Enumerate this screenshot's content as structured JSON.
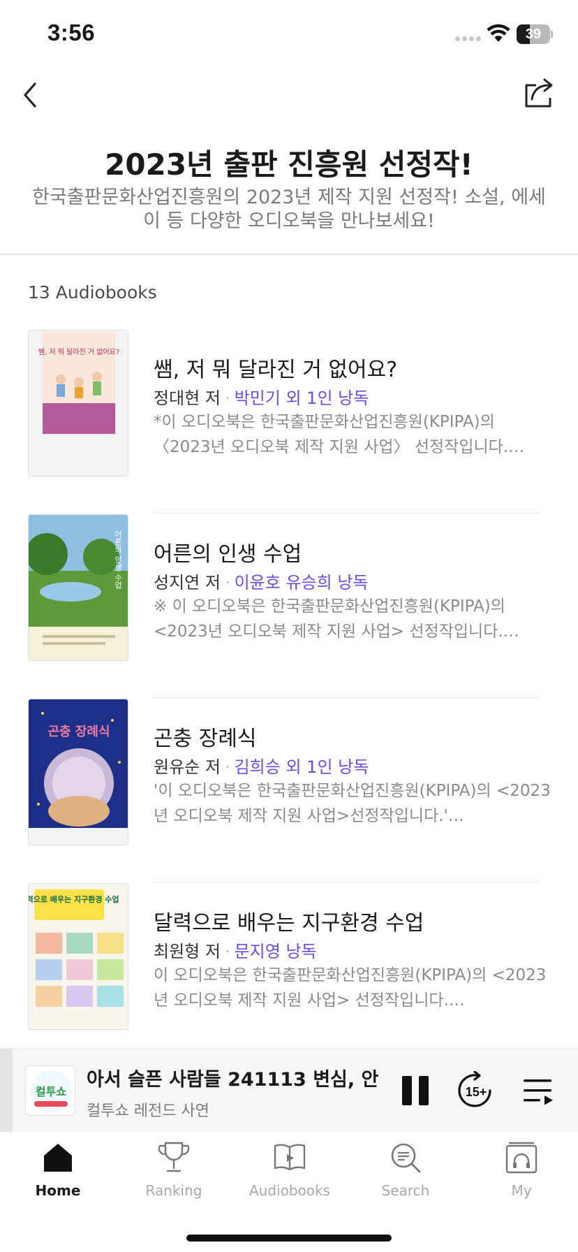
{
  "status_bar": {
    "time": "3:56",
    "battery": "39",
    "battery_level": 0.39
  },
  "header": {
    "title": "2023년 출판 진흥원 선정작!",
    "subtitle": "한국출판문화산업진흥원의 2023년 제작 지원 선정작! 소설, 에세이 등 다양한 오디오북을 만나보세요!"
  },
  "list": {
    "count_label": "13 Audiobooks",
    "books": [
      {
        "title": "쌤, 저 뭐 달라진 거 없어요?",
        "author": "정대현 저",
        "narrator": "박민기 외 1인 낭독",
        "description": "*이 오디오북은 한국출판문화산업진흥원(KPIPA)의 〈2023년 오디오북 제작 지원 사업〉 선정작입니다.…",
        "cover_text": "쌤, 저 뭐 달라진 거 없어요?"
      },
      {
        "title": "어른의 인생 수업",
        "author": "성지연 저",
        "narrator": "이윤호 유승희 낭독",
        "description": "※ 이 오디오북은 한국출판문화산업진흥원(KPIPA)의 <2023년 오디오북 제작 지원 사업> 선정작입니다.…",
        "cover_text": "어른의 인생 수업"
      },
      {
        "title": "곤충 장례식",
        "author": "원유순 저",
        "narrator": "김희승 외 1인 낭독",
        "description": "'이 오디오북은 한국출판문화산업진흥원(KPIPA)의 <2023년 오디오북 제작 지원 사업>선정작입니다.'…",
        "cover_text": "곤충 장례식"
      },
      {
        "title": "달력으로 배우는 지구환경 수업",
        "author": "최원형 저",
        "narrator": "문지영 낭독",
        "description": "이 오디오북은 한국출판문화산업진흥원(KPIPA)의 <2023년 오디오북 제작 지원 사업> 선정작입니다.…",
        "cover_text": "달력으로 배우는 지구환경 수업"
      }
    ]
  },
  "player": {
    "title": "아서 슬픈 사람들      241113 변심, 안",
    "subtitle": "컬투쇼 레전드 사연",
    "thumb_text": "컬투쇼",
    "skip_label": "15+"
  },
  "tabs": [
    {
      "label": "Home",
      "icon": "home-icon",
      "active": true
    },
    {
      "label": "Ranking",
      "icon": "trophy-icon",
      "active": false
    },
    {
      "label": "Audiobooks",
      "icon": "book-play-icon",
      "active": false
    },
    {
      "label": "Search",
      "icon": "search-icon",
      "active": false
    },
    {
      "label": "My",
      "icon": "headphones-library-icon",
      "active": false
    }
  ],
  "colors": {
    "accent": "#6a4ce0",
    "text": "#1a1a1a",
    "muted": "#8a8a8a"
  }
}
